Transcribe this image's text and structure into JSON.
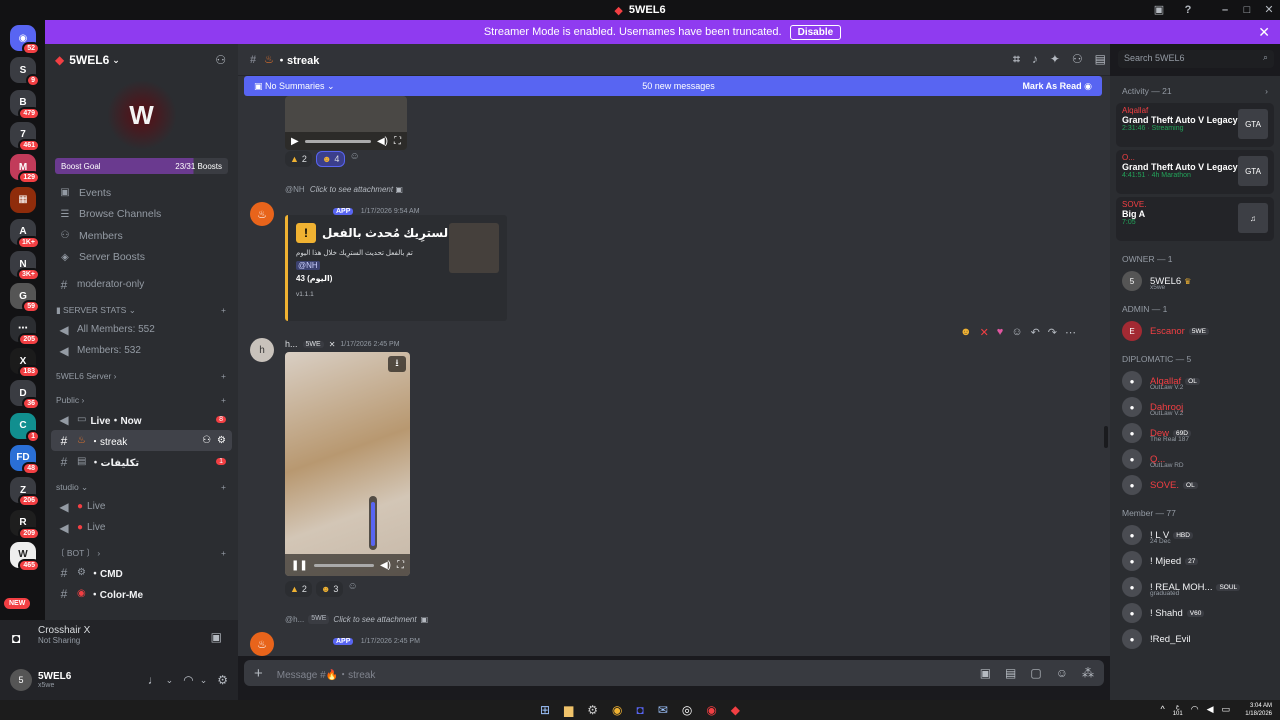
{
  "window": {
    "title": "5WEL6"
  },
  "banner": {
    "text": "Streamer Mode is enabled. Usernames have been truncated.",
    "disable_label": "Disable"
  },
  "servers": [
    {
      "icon": "discord-icon",
      "badge": "52",
      "color": "#5865f2",
      "label": "◉"
    },
    {
      "icon": "server-icon",
      "badge": "9",
      "color": "#3a3c42",
      "label": "S"
    },
    {
      "icon": "server-icon",
      "badge": "479",
      "color": "#3a3c42",
      "label": "B"
    },
    {
      "icon": "server-icon",
      "badge": "461",
      "color": "#3a3c42",
      "label": "7"
    },
    {
      "icon": "server-icon",
      "badge": "129",
      "color": "#c23b5a",
      "label": "M"
    },
    {
      "icon": "server-icon",
      "badge": "",
      "color": "#8f2c0b",
      "label": "▦"
    },
    {
      "icon": "server-icon",
      "badge": "1K+",
      "color": "#3a3c42",
      "label": "A"
    },
    {
      "icon": "server-icon",
      "badge": "3K+",
      "color": "#3a3c42",
      "label": "N"
    },
    {
      "icon": "server-icon",
      "badge": "59",
      "color": "#555",
      "label": "G"
    },
    {
      "icon": "server-icon",
      "badge": "205",
      "color": "#2b2d31",
      "label": "⋯"
    },
    {
      "icon": "server-icon",
      "badge": "183",
      "color": "#1b1b1b",
      "label": "X"
    },
    {
      "icon": "server-icon",
      "badge": "36",
      "color": "#3a3c42",
      "label": "D"
    },
    {
      "icon": "server-icon",
      "badge": "1",
      "color": "#118f8f",
      "label": "C"
    },
    {
      "icon": "server-icon",
      "badge": "48",
      "color": "#2a6fd6",
      "label": "FD"
    },
    {
      "icon": "server-icon",
      "badge": "206",
      "color": "#3a3c42",
      "label": "Z"
    },
    {
      "icon": "server-icon",
      "badge": "209",
      "color": "#1e1e1e",
      "label": "R"
    },
    {
      "icon": "server-icon",
      "badge": "465",
      "color": "#eee",
      "label": "W"
    }
  ],
  "new_label": "NEW",
  "sidebar": {
    "server_name": "5WEL6",
    "logo_text": "W",
    "boost_goal_label": "Boost Goal",
    "boost_count": "23/31 Boosts",
    "boost_progress": 0.74,
    "nav": [
      {
        "icon": "calendar-icon",
        "glyph": "▣",
        "label": "Events"
      },
      {
        "icon": "browse-icon",
        "glyph": "☰",
        "label": "Browse Channels"
      },
      {
        "icon": "members-icon",
        "glyph": "⚇",
        "label": "Members"
      },
      {
        "icon": "boost-icon",
        "glyph": "◈",
        "label": "Server Boosts"
      }
    ],
    "moderator_channel": "moderator-only",
    "cat_stats": "SERVER STATS",
    "stat_all": "All Members: 552",
    "stat_members": "Members: 532",
    "cat_server": "5WEL6 Server",
    "cat_public": "Public",
    "ch_live_now": "Live・Now",
    "ch_live_now_badge": "8",
    "ch_streak": "・streak",
    "ch_takleef": "・تكليفات",
    "ch_takleef_badge": "1",
    "cat_studio": "studio",
    "ch_live1": "Live",
    "ch_live2": "Live",
    "cat_bot": "〔 BOT 〕",
    "ch_cmd": "・CMD",
    "ch_colorme": "・Color-Me"
  },
  "voice": {
    "title": "Crosshair X",
    "status": "Not Sharing"
  },
  "user": {
    "name": "5WEL6",
    "status": "x5we"
  },
  "channel": {
    "name": "・streak",
    "search_placeholder": "Search 5WEL6"
  },
  "summary": {
    "label": "No Summaries",
    "new_messages": "50 new messages",
    "mark_read": "Mark As Read"
  },
  "messages": {
    "m1_react1": "2",
    "m1_react2": "4",
    "m2_reply": "@NH",
    "m2_reply_text": "Click to see attachment",
    "m2_app": "APP",
    "m2_time": "1/17/2026 9:54 AM",
    "embed_title": "السترِيك مُحدث بالفعل •",
    "embed_line1": "تم بالفعل تحديث السترِيك خلال هذا اليوم",
    "embed_line2": "@NH",
    "embed_line3": "43 (اليوم)",
    "embed_footer": "v1.1.1",
    "m3_author": "h...",
    "m3_tag": "5WE",
    "m3_time": "1/17/2026 2:45 PM",
    "m3_react1": "2",
    "m3_react2": "3",
    "m4_reply": "@h...",
    "m4_tag": "5WE",
    "m4_reply_text": "Click to see attachment",
    "m4_app": "APP",
    "m4_time": "1/17/2026 2:45 PM"
  },
  "composer": {
    "placeholder": "Message #🔥・streak"
  },
  "members": {
    "activity_title": "Activity — 21",
    "activities": [
      {
        "name": "Alqallaf",
        "game": "Grand Theft Auto V Legacy",
        "info": "2:31:46 · Streaming",
        "thumb": "GTA"
      },
      {
        "name": "O...",
        "game": "Grand Theft Auto V Legacy",
        "info": "4:41:51 · 4h Marathon",
        "thumb": "GTA"
      },
      {
        "name": "SOVE.",
        "game": "Big A",
        "info": "7:05",
        "thumb": "♫"
      }
    ],
    "owner_title": "OWNER — 1",
    "owner": {
      "name": "5WEL6",
      "sub": "x5we"
    },
    "admin_title": "ADMIN — 1",
    "admin": {
      "name": "Escanor",
      "tag": "5WE"
    },
    "diplomatic_title": "DIPLOMATIC — 5",
    "diplomatic": [
      {
        "name": "Alqallaf",
        "tag": "OL",
        "sub": "OutLaw V.2",
        "color": "#f23f43"
      },
      {
        "name": "Dahrooj",
        "tag": "",
        "sub": "OutLaw V.2",
        "color": "#f23f43"
      },
      {
        "name": "Dew",
        "tag": "69D",
        "sub": "The Real 187",
        "color": "#f23f43"
      },
      {
        "name": "Q...",
        "tag": "",
        "sub": "OutLaw RD",
        "color": "#f23f43"
      },
      {
        "name": "SOVE.",
        "tag": "OL",
        "sub": "",
        "color": "#f23f43"
      }
    ],
    "member_title": "Member — 77",
    "members": [
      {
        "name": "! L V",
        "tag": "HBD",
        "sub": "24 Dec"
      },
      {
        "name": "! Mjeed",
        "tag": "27",
        "sub": ""
      },
      {
        "name": "! REAL MOH...",
        "tag": "SOUL",
        "sub": "graduated"
      },
      {
        "name": "! Shahd",
        "tag": "V60",
        "sub": ""
      },
      {
        "name": "!Red_Evil",
        "tag": "",
        "sub": ""
      }
    ]
  },
  "taskbar": {
    "lang": "ع",
    "lang2": "101",
    "time": "3:04 AM",
    "date": "1/18/2026"
  }
}
